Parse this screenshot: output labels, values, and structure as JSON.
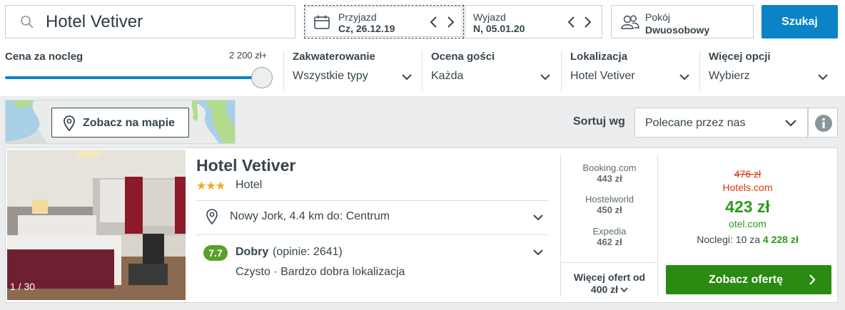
{
  "search": {
    "value": "Hotel Vetiver",
    "button_label": "Szukaj"
  },
  "checkin": {
    "label": "Przyjazd",
    "value": "Cz, 26.12.19"
  },
  "checkout": {
    "label": "Wyjazd",
    "value": "N, 05.01.20"
  },
  "room": {
    "label": "Pokój",
    "value": "Dwuosobowy"
  },
  "filters": {
    "price": {
      "label": "Cena za nocleg",
      "max": "2 200 zł+",
      "level_percent": 100
    },
    "accommodation": {
      "label": "Zakwaterowanie",
      "value": "Wszystkie typy"
    },
    "rating": {
      "label": "Ocena gości",
      "value": "Każda"
    },
    "location": {
      "label": "Lokalizacja",
      "value": "Hotel Vetiver"
    },
    "more": {
      "label": "Więcej opcji",
      "value": "Wybierz"
    }
  },
  "map": {
    "button_label": "Zobacz na mapie"
  },
  "sort": {
    "label": "Sortuj wg",
    "value": "Polecane przez nas"
  },
  "hotel": {
    "photo_count": "1 / 30",
    "name": "Hotel Vetiver",
    "stars": "★★★",
    "type": "Hotel",
    "location": "Nowy Jork, 4.4 km do: Centrum",
    "rating_score": "7.7",
    "rating_word": "Dobry",
    "rating_count": "(opinie: 2641)",
    "rating_desc": "Czysto · Bardzo dobra lokalizacja"
  },
  "providers": [
    {
      "name": "Booking.com",
      "price": "443 zł"
    },
    {
      "name": "Hostelworld",
      "price": "450 zł"
    },
    {
      "name": "Expedia",
      "price": "462 zł"
    }
  ],
  "more_offers": {
    "line1": "Więcej ofert od",
    "line2": "400 zł"
  },
  "offer": {
    "old_price": "476 zł",
    "old_site": "Hotels.com",
    "price": "423 zł",
    "site": "otel.com",
    "nights_prefix": "Noclegi: 10 za",
    "nights_total": "4 228 zł",
    "button_label": "Zobacz ofertę"
  },
  "colors": {
    "accent": "#0a83c7",
    "cta": "#2a8a11",
    "price_green": "#2d9a1e",
    "old_price_red": "#d4380d",
    "stars": "#f5a623"
  }
}
